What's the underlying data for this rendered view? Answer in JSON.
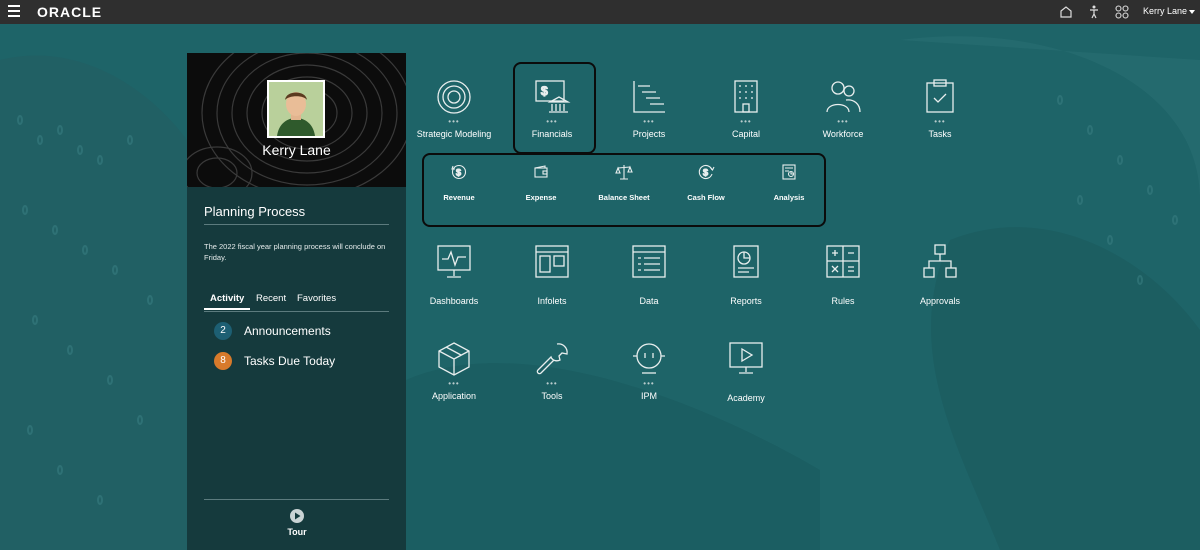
{
  "topbar": {
    "brand": "ORACLE",
    "user_name": "Kerry Lane",
    "icons": [
      "home-icon",
      "accessibility-icon",
      "navigator-icon"
    ]
  },
  "profile": {
    "name": "Kerry Lane"
  },
  "planning": {
    "title": "Planning Process",
    "message": "The 2022 fiscal year planning process will conclude on Friday."
  },
  "tabs": [
    {
      "label": "Activity",
      "active": true
    },
    {
      "label": "Recent",
      "active": false
    },
    {
      "label": "Favorites",
      "active": false
    }
  ],
  "feed": [
    {
      "count": "2",
      "label": "Announcements",
      "color": "#1d5f73"
    },
    {
      "count": "8",
      "label": "Tasks Due Today",
      "color": "#d77a2b"
    }
  ],
  "tour": {
    "label": "Tour"
  },
  "tiles": {
    "strategic_modeling": "Strategic Modeling",
    "financials": "Financials",
    "projects": "Projects",
    "capital": "Capital",
    "workforce": "Workforce",
    "tasks": "Tasks",
    "dashboards": "Dashboards",
    "infolets": "Infolets",
    "data": "Data",
    "reports": "Reports",
    "rules": "Rules",
    "approvals": "Approvals",
    "application": "Application",
    "tools": "Tools",
    "ipm": "IPM",
    "academy": "Academy",
    "dots": "•••"
  },
  "financials_cards": {
    "revenue": "Revenue",
    "expense": "Expense",
    "balance_sheet": "Balance Sheet",
    "cash_flow": "Cash Flow",
    "analysis": "Analysis"
  },
  "colors": {
    "background": "#1e6468",
    "topbar": "#2f2f2f",
    "panel": "#153a3d",
    "highlight": "#0b0b0b"
  }
}
